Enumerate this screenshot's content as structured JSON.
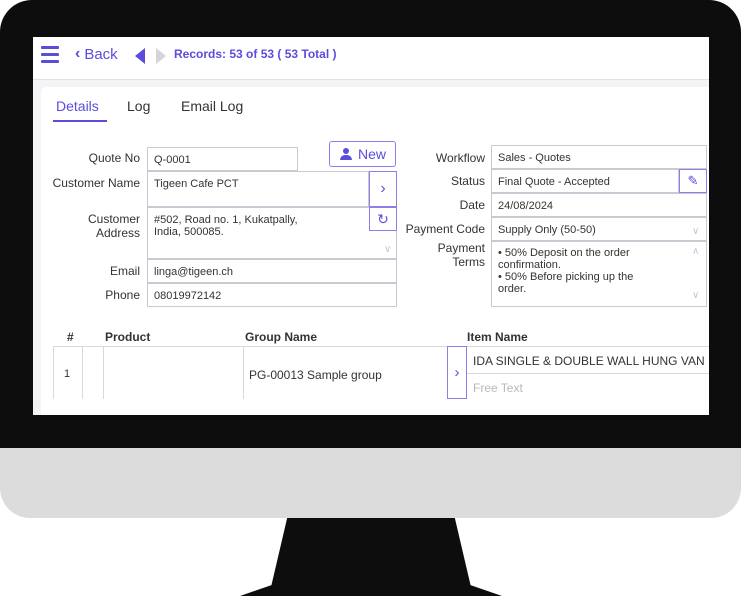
{
  "topbar": {
    "back_label": "Back",
    "records": "Records: 53 of 53  ( 53 Total )"
  },
  "tabs": [
    "Details",
    "Log",
    "Email Log"
  ],
  "new_button_label": "New",
  "form_left": {
    "quote_no": {
      "label": "Quote No",
      "value": "Q-0001"
    },
    "customer_name": {
      "label": "Customer Name",
      "value": "Tigeen Cafe PCT"
    },
    "customer_address": {
      "label_line1": "Customer",
      "label_line2": "Address",
      "line1": "#502, Road no. 1, Kukatpally,",
      "line2": "India, 500085."
    },
    "email": {
      "label": "Email",
      "value": "linga@tigeen.ch"
    },
    "phone": {
      "label": "Phone",
      "value": "08019972142"
    }
  },
  "form_right": {
    "workflow": {
      "label": "Workflow",
      "value": "Sales - Quotes"
    },
    "status": {
      "label": "Status",
      "value": "Final Quote - Accepted"
    },
    "date": {
      "label": "Date",
      "value": "24/08/2024"
    },
    "payment_code": {
      "label": "Payment Code",
      "value": "Supply Only (50-50)"
    },
    "payment_terms": {
      "label_line1": "Payment",
      "label_line2": "Terms",
      "lines": [
        "• 50% Deposit on the order",
        "confirmation.",
        "• 50% Before picking up the",
        "order."
      ]
    }
  },
  "table": {
    "headers": {
      "num": "#",
      "product": "Product",
      "group_name": "Group Name",
      "item_name": "Item Name"
    },
    "rows": [
      {
        "num": "1",
        "product": "",
        "group_name": "PG-00013 Sample group",
        "item_name": "IDA SINGLE & DOUBLE WALL HUNG VAN",
        "free_text_placeholder": "Free Text"
      }
    ]
  }
}
